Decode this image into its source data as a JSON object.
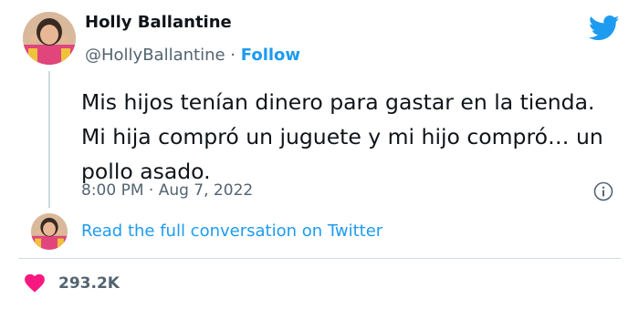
{
  "author": {
    "name": "Holly Ballantine",
    "handle": "@HollyBallantine",
    "separator": "·",
    "follow_label": "Follow"
  },
  "tweet": {
    "lines": [
      "Mis hijos tenían dinero para gastar en la tienda.",
      "Mi hija compró un juguete y mi hijo compró… un",
      "pollo asado."
    ],
    "timestamp": "8:00 PM · Aug 7, 2022"
  },
  "read_link": "Read the full conversation on Twitter",
  "likes": "293.2K",
  "icons": {
    "logo": "twitter-bird-icon",
    "info": "info-icon",
    "like": "heart-icon"
  },
  "colors": {
    "accent": "#1d9bf0",
    "heart": "#f91880",
    "muted": "#536471",
    "text": "#0f1419"
  }
}
